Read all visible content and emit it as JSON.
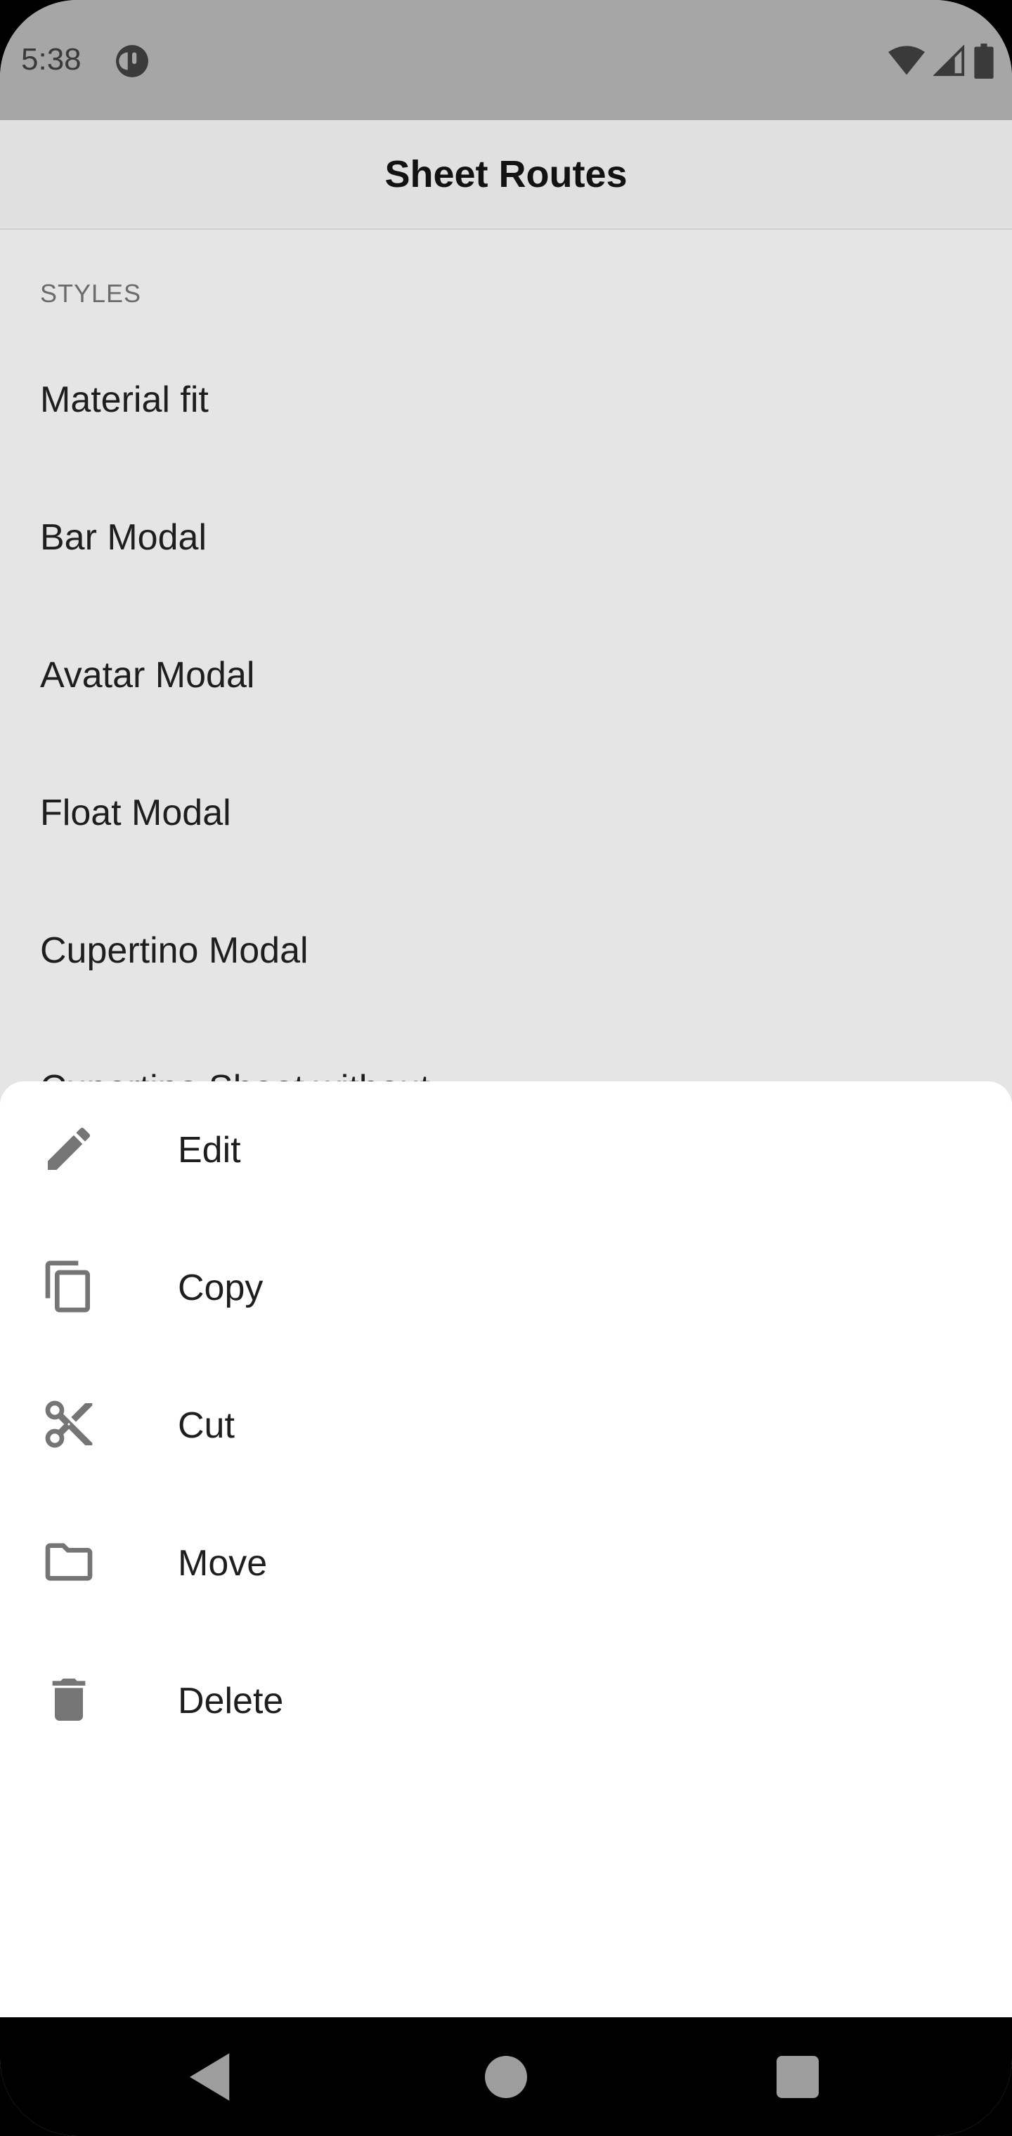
{
  "status_bar": {
    "time": "5:38",
    "icons": [
      "app-notification-icon",
      "wifi-icon",
      "cellular-signal-icon",
      "battery-icon"
    ]
  },
  "app_bar": {
    "title": "Sheet Routes"
  },
  "list": {
    "section_header": "STYLES",
    "items": [
      {
        "label": "Material fit"
      },
      {
        "label": "Bar Modal"
      },
      {
        "label": "Avatar Modal"
      },
      {
        "label": "Float Modal"
      },
      {
        "label": "Cupertino Modal"
      },
      {
        "label": "Cupertino Sheet without"
      }
    ]
  },
  "sheet": {
    "items": [
      {
        "label": "Edit",
        "icon": "pencil-icon"
      },
      {
        "label": "Copy",
        "icon": "copy-icon"
      },
      {
        "label": "Cut",
        "icon": "scissors-icon"
      },
      {
        "label": "Move",
        "icon": "folder-icon"
      },
      {
        "label": "Delete",
        "icon": "trash-icon"
      }
    ]
  },
  "nav_bar": {
    "buttons": [
      "back-icon",
      "home-icon",
      "recents-icon"
    ]
  },
  "colors": {
    "status_bar": "#a6a6a6",
    "app_bar": "#e0e0e0",
    "list_background": "#e5e5e5",
    "sheet_background": "#ffffff",
    "icon_gray": "#757575",
    "nav_bar": "#000000"
  }
}
